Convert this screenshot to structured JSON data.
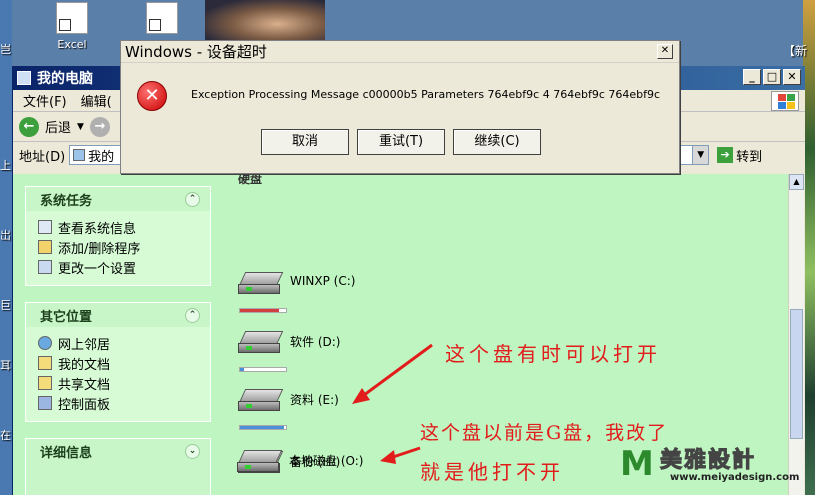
{
  "desktop": {
    "icons": [
      {
        "label": "Excel"
      },
      {
        "label": ""
      }
    ],
    "right_tag": "【新",
    "left_fragments": [
      "岂",
      "上",
      "岀",
      "巨",
      "耳",
      "在"
    ]
  },
  "explorer": {
    "title": "我的电脑",
    "menu": [
      "文件(F)",
      "编辑("
    ],
    "toolbar": {
      "back": "后退"
    },
    "address": {
      "label": "地址(D)",
      "value": "我的",
      "go": "转到"
    },
    "tasks_panel": {
      "title": "系统任务",
      "items": [
        "查看系统信息",
        "添加/删除程序",
        "更改一个设置"
      ]
    },
    "places_panel": {
      "title": "其它位置",
      "items": [
        "网上邻居",
        "我的文档",
        "共享文档",
        "控制面板"
      ]
    },
    "details_panel": {
      "title": "详细信息"
    },
    "group_title": "硬盘",
    "drives": [
      {
        "label": "WINXP (C:)",
        "fill": 0.85,
        "bar_color": "#d04040"
      },
      {
        "label": "软件 (D:)",
        "fill": 0.08,
        "bar_color": "#4a90d9"
      },
      {
        "label": "资料 (E:)",
        "fill": 0.95,
        "bar_color": "#4a90d9"
      },
      {
        "label": "备份 (H:)"
      },
      {
        "label": "本地磁盘 (O:)"
      }
    ]
  },
  "annotations": {
    "h_drive_note": "这个盘有时可以打开",
    "o_drive_note_line1": "这个盘以前是G盘，我改了",
    "o_drive_note_line2": "就是他打不开"
  },
  "watermark": {
    "logo": "M",
    "name": "美雅設計",
    "url": "www.meiyadesign.com"
  },
  "dialog": {
    "title": "Windows - 设备超时",
    "message": "Exception Processing Message c00000b5 Parameters 764ebf9c 4 764ebf9c 764ebf9c",
    "buttons": [
      "取消",
      "重试(T)",
      "继续(C)"
    ]
  }
}
